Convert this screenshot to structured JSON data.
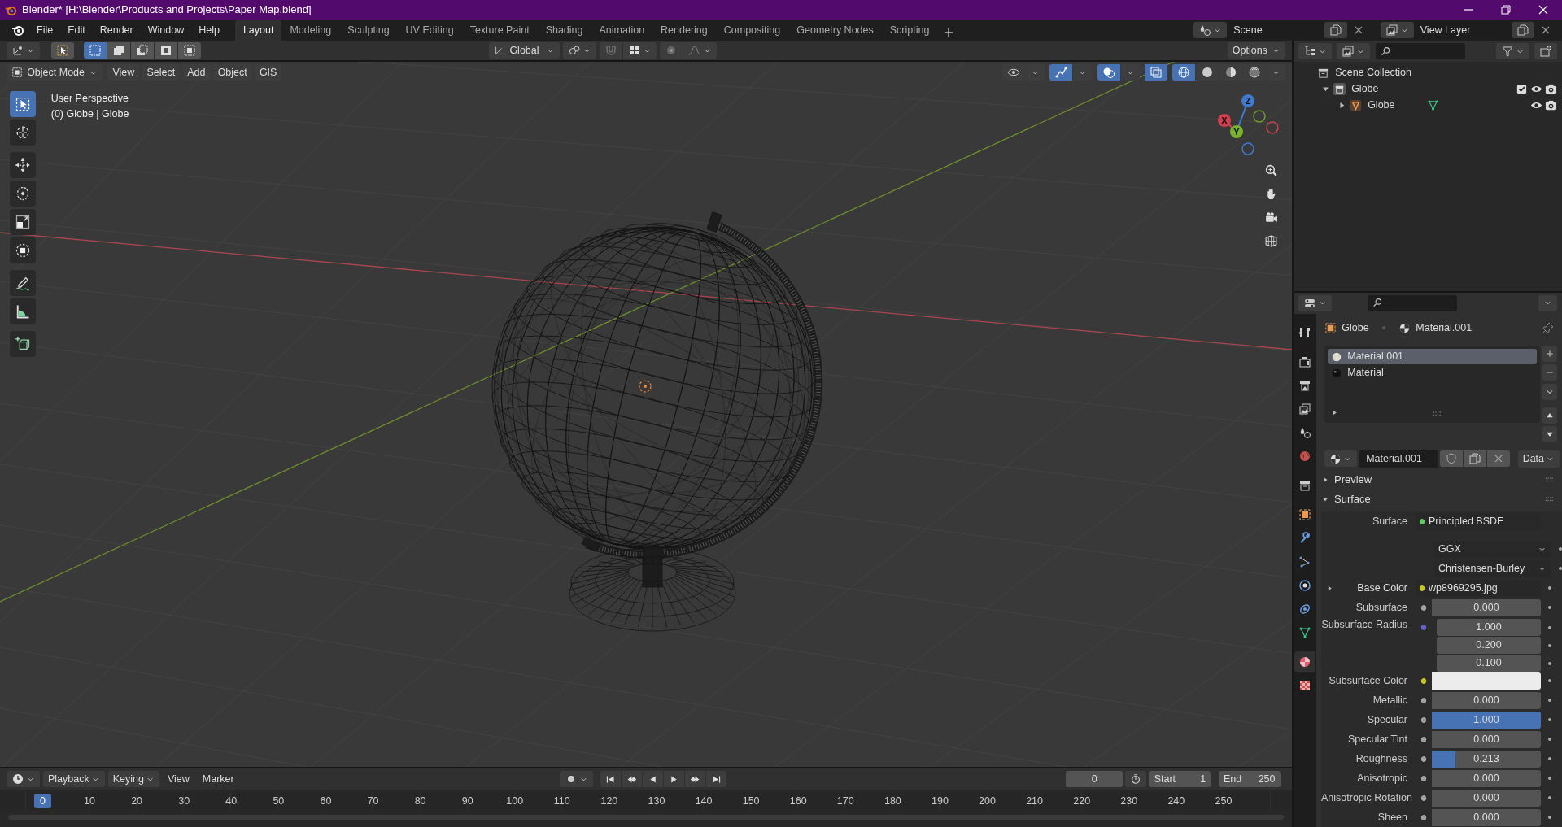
{
  "window": {
    "title": "Blender* [H:\\Blender\\Products and Projects\\Paper Map.blend]"
  },
  "menu": [
    "File",
    "Edit",
    "Render",
    "Window",
    "Help"
  ],
  "workspaces": [
    {
      "label": "Layout",
      "selected": true
    },
    {
      "label": "Modeling",
      "selected": false
    },
    {
      "label": "Sculpting",
      "selected": false
    },
    {
      "label": "UV Editing",
      "selected": false
    },
    {
      "label": "Texture Paint",
      "selected": false
    },
    {
      "label": "Shading",
      "selected": false
    },
    {
      "label": "Animation",
      "selected": false
    },
    {
      "label": "Rendering",
      "selected": false
    },
    {
      "label": "Compositing",
      "selected": false
    },
    {
      "label": "Geometry Nodes",
      "selected": false
    },
    {
      "label": "Scripting",
      "selected": false
    }
  ],
  "scene": {
    "name": "Scene"
  },
  "view_layer": {
    "name": "View Layer"
  },
  "tool_header": {
    "select_modes": [
      {
        "kind": "set",
        "selected": true
      },
      {
        "kind": "extend",
        "selected": false
      },
      {
        "kind": "subtract",
        "selected": false
      },
      {
        "kind": "invert",
        "selected": false
      },
      {
        "kind": "intersect",
        "selected": false
      }
    ],
    "orientation": "Global",
    "options": "Options"
  },
  "viewport_header": {
    "mode": "Object Mode",
    "menus": [
      "View",
      "Select",
      "Add",
      "Object",
      "GIS"
    ],
    "toggles": [
      {
        "kind": "visibility",
        "on": false
      },
      {
        "kind": "gizmos",
        "on": true
      },
      {
        "kind": "overlays",
        "on": true
      },
      {
        "kind": "xray",
        "on": true
      }
    ],
    "shading": [
      {
        "kind": "wireframe",
        "selected": true
      },
      {
        "kind": "solid",
        "selected": false
      },
      {
        "kind": "material",
        "selected": false
      },
      {
        "kind": "rendered",
        "selected": false
      }
    ]
  },
  "viewport": {
    "overlay_text": [
      "User Perspective",
      "(0) Globe | Globe"
    ],
    "gizmo": {
      "x": "X",
      "y": "Y",
      "z": "Z"
    }
  },
  "toolbar": [
    {
      "kind": "select-box",
      "selected": true
    },
    {
      "kind": "cursor",
      "selected": false
    },
    {
      "kind": "move",
      "selected": false
    },
    {
      "kind": "rotate",
      "selected": false
    },
    {
      "kind": "scale",
      "selected": false
    },
    {
      "kind": "transform",
      "selected": false
    },
    {
      "kind": "annotate",
      "selected": false
    },
    {
      "kind": "measure",
      "selected": false
    },
    {
      "kind": "add-cube",
      "selected": false
    }
  ],
  "outliner": {
    "items": [
      {
        "label": "Scene Collection",
        "kind": "scene-collection",
        "children": [
          {
            "label": "Globe",
            "kind": "collection",
            "expanded": true,
            "checked": true,
            "children": [
              {
                "label": "Globe",
                "kind": "mesh-object",
                "expanded": false
              }
            ]
          }
        ]
      }
    ]
  },
  "properties": {
    "tabs": [
      {
        "kind": "tool",
        "selected": false
      },
      {
        "kind": "render",
        "selected": false
      },
      {
        "kind": "output",
        "selected": false
      },
      {
        "kind": "view-layer",
        "selected": false
      },
      {
        "kind": "scene",
        "selected": false
      },
      {
        "kind": "world",
        "selected": false
      },
      {
        "kind": "collection",
        "selected": false
      },
      {
        "kind": "object",
        "selected": false
      },
      {
        "kind": "modifiers",
        "selected": false
      },
      {
        "kind": "particles",
        "selected": false
      },
      {
        "kind": "physics",
        "selected": false
      },
      {
        "kind": "constraints",
        "selected": false
      },
      {
        "kind": "data",
        "selected": false
      },
      {
        "kind": "material",
        "selected": true
      },
      {
        "kind": "texture",
        "selected": false
      }
    ],
    "breadcrumb": [
      "Globe",
      "Material.001"
    ],
    "slots": [
      {
        "name": "Material.001",
        "kind": "light",
        "selected": true
      },
      {
        "name": "Material",
        "kind": "dark",
        "selected": false
      }
    ],
    "material": {
      "name": "Material.001",
      "link": "Data"
    },
    "panels": [
      {
        "label": "Preview",
        "expanded": false
      },
      {
        "label": "Surface",
        "expanded": true
      }
    ],
    "fields": [
      {
        "kind": "shader",
        "label": "Surface",
        "value": "Principled BSDF"
      },
      {
        "kind": "dropdown",
        "value": "GGX"
      },
      {
        "kind": "dropdown",
        "value": "Christensen-Burley"
      },
      {
        "kind": "texture",
        "label": "Base Color",
        "value": "wp8969295.jpg",
        "expanded": false
      },
      {
        "kind": "slider",
        "label": "Subsurface",
        "value": "0.000"
      },
      {
        "kind": "vector",
        "label": "Subsurface Radius",
        "values": [
          "1.000",
          "0.200",
          "0.100"
        ]
      },
      {
        "kind": "color",
        "label": "Subsurface Color",
        "color": "#ececec"
      },
      {
        "kind": "slider",
        "label": "Metallic",
        "value": "0.000"
      },
      {
        "kind": "slider",
        "label": "Specular",
        "value": "1.000",
        "level": 1
      },
      {
        "kind": "slider",
        "label": "Specular Tint",
        "value": "0.000"
      },
      {
        "kind": "slider",
        "label": "Roughness",
        "value": "0.213",
        "level": 0.213
      },
      {
        "kind": "slider",
        "label": "Anisotropic",
        "value": "0.000"
      },
      {
        "kind": "slider",
        "label": "Anisotropic Rotation",
        "value": "0.000"
      },
      {
        "kind": "slider",
        "label": "Sheen",
        "value": "0.000"
      }
    ]
  },
  "timeline": {
    "menus": [
      "Playback",
      "Keying",
      "View",
      "Marker"
    ],
    "auto_keying": {
      "on": false
    },
    "current_frame": "0",
    "start_label": "Start",
    "start": "1",
    "end_label": "End",
    "end": "250",
    "playhead": "0",
    "ruler": [
      "10",
      "20",
      "30",
      "40",
      "50",
      "60",
      "70",
      "80",
      "90",
      "100",
      "110",
      "120",
      "130",
      "140",
      "150",
      "160",
      "170",
      "180",
      "190",
      "200",
      "210",
      "220",
      "230",
      "240",
      "250"
    ]
  }
}
